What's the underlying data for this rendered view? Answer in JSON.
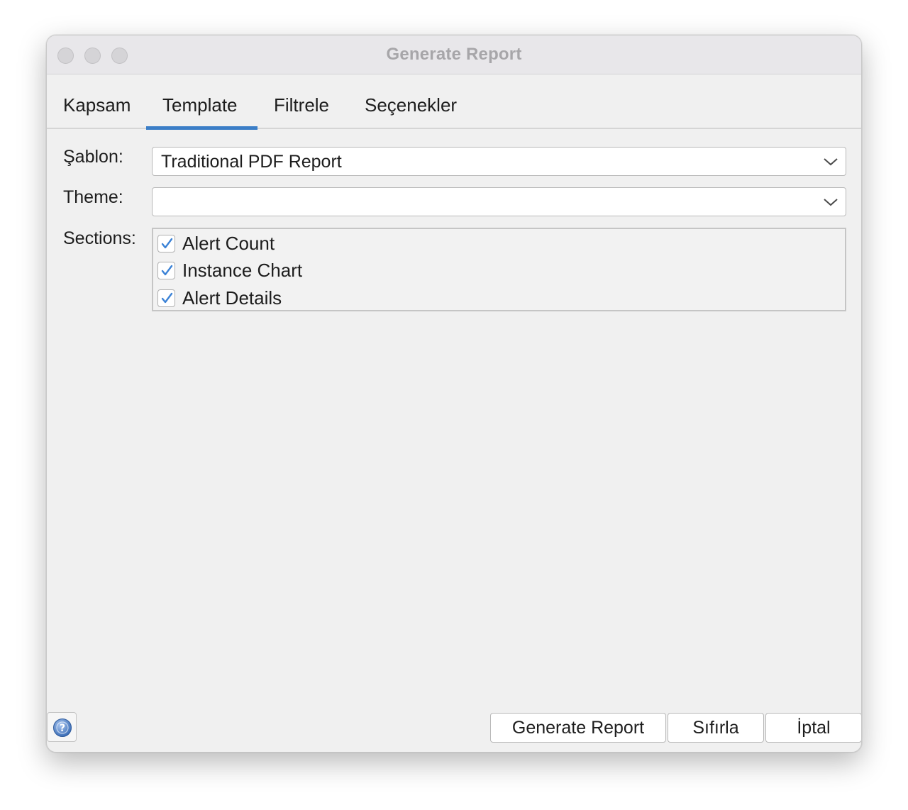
{
  "window": {
    "title": "Generate Report"
  },
  "tabs": [
    {
      "label": "Kapsam",
      "selected": false
    },
    {
      "label": "Template",
      "selected": true
    },
    {
      "label": "Filtrele",
      "selected": false
    },
    {
      "label": "Seçenekler",
      "selected": false
    }
  ],
  "form": {
    "template_label": "Şablon:",
    "template_value": "Traditional PDF Report",
    "theme_label": "Theme:",
    "theme_value": "",
    "sections_label": "Sections:",
    "sections": [
      {
        "label": "Alert Count",
        "checked": true
      },
      {
        "label": "Instance Chart",
        "checked": true
      },
      {
        "label": "Alert Details",
        "checked": true
      }
    ]
  },
  "buttons": {
    "generate": "Generate Report",
    "reset": "Sıfırla",
    "cancel": "İptal"
  },
  "icons": {
    "help": "help-icon",
    "dropdown": "chevron-down-icon",
    "check": "checkmark-icon"
  },
  "colors": {
    "accent": "#3b7ec7",
    "window_bg": "#f0f0f0"
  }
}
